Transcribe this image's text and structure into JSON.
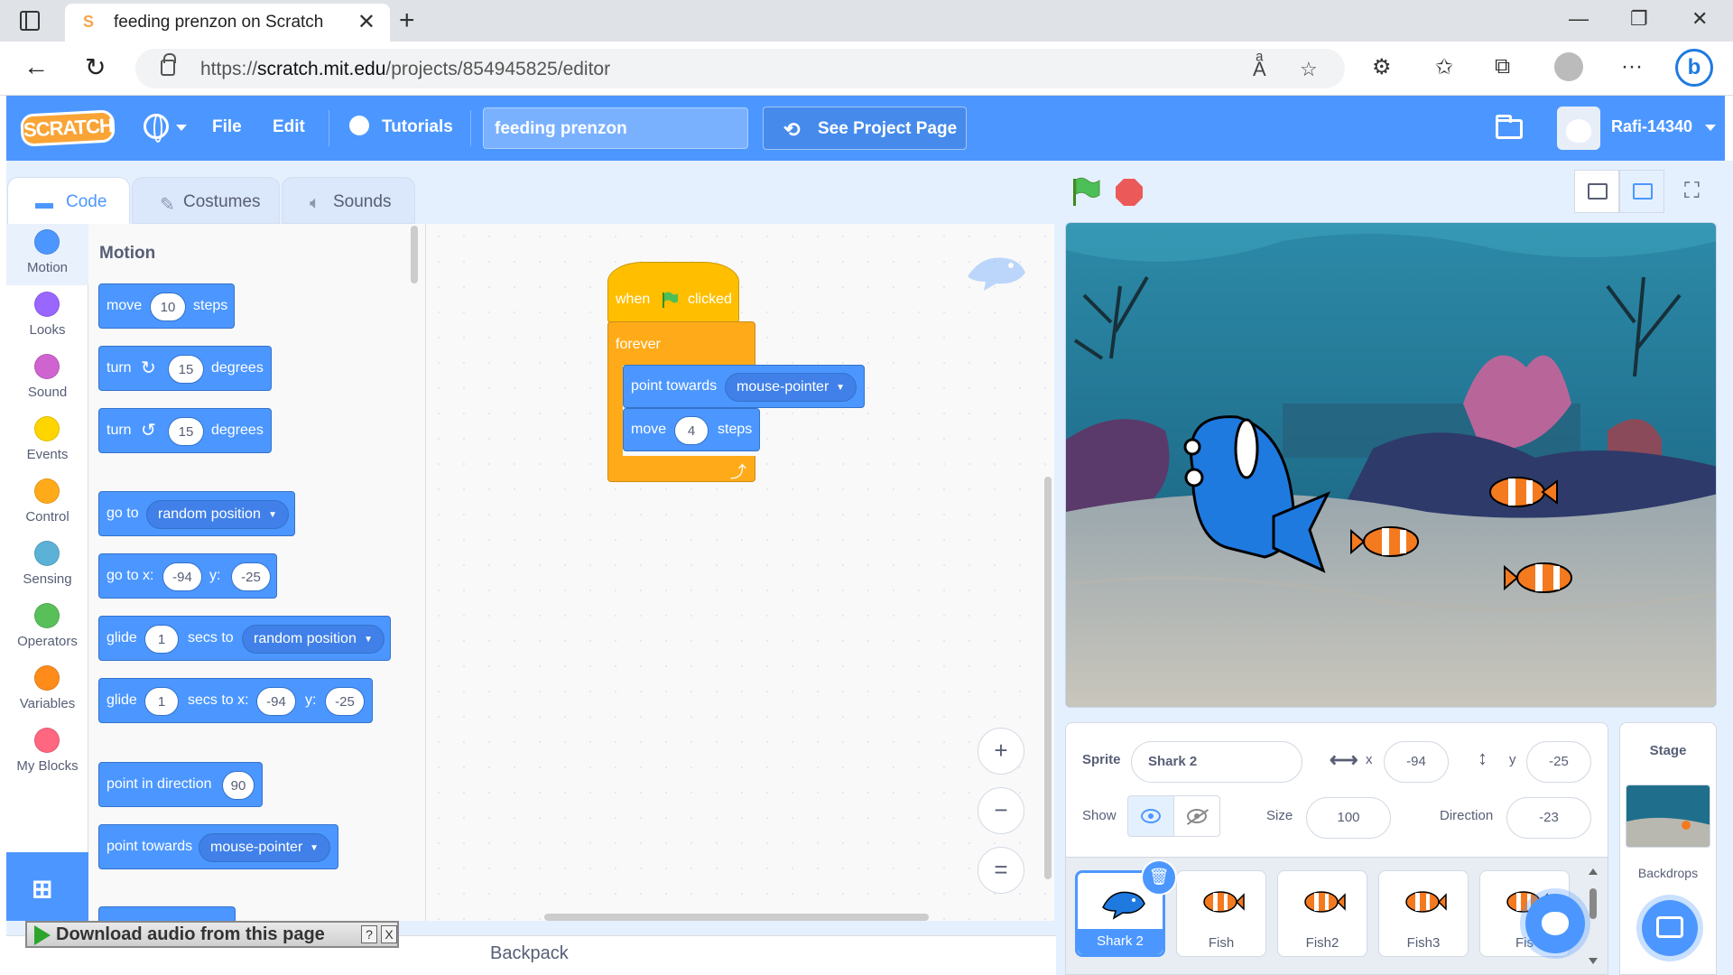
{
  "browser": {
    "tab_title": "feeding prenzon on Scratch",
    "url_prefix": "https://",
    "url_host": "scratch.mit.edu",
    "url_path": "/projects/854945825/editor"
  },
  "menubar": {
    "logo": "SCRATCH",
    "file": "File",
    "edit": "Edit",
    "tutorials": "Tutorials",
    "project_title": "feeding prenzon",
    "see_project_page": "See Project Page",
    "username": "Rafi-14340",
    "accent": "#4c97ff"
  },
  "editor_tabs": [
    {
      "label": "Code",
      "icon": "code-icon"
    },
    {
      "label": "Costumes",
      "icon": "brush-icon"
    },
    {
      "label": "Sounds",
      "icon": "speaker-icon"
    }
  ],
  "categories": [
    {
      "label": "Motion",
      "color": "#4c97ff"
    },
    {
      "label": "Looks",
      "color": "#9966ff"
    },
    {
      "label": "Sound",
      "color": "#cf63cf"
    },
    {
      "label": "Events",
      "color": "#ffd500"
    },
    {
      "label": "Control",
      "color": "#ffab19"
    },
    {
      "label": "Sensing",
      "color": "#5cb1d6"
    },
    {
      "label": "Operators",
      "color": "#59c059"
    },
    {
      "label": "Variables",
      "color": "#ff8c1a"
    },
    {
      "label": "My Blocks",
      "color": "#ff6680"
    }
  ],
  "palette": {
    "heading": "Motion",
    "move": {
      "a": "move",
      "n": "10",
      "b": "steps"
    },
    "turn_right": {
      "a": "turn",
      "n": "15",
      "b": "degrees"
    },
    "turn_left": {
      "a": "turn",
      "n": "15",
      "b": "degrees"
    },
    "goto": {
      "a": "go to",
      "d": "random position"
    },
    "goto_xy": {
      "a": "go to x:",
      "x": "-94",
      "b": "y:",
      "y": "-25"
    },
    "glide": {
      "a": "glide",
      "n": "1",
      "b": "secs to",
      "d": "random position"
    },
    "glide_xy": {
      "a": "glide",
      "n": "1",
      "b": "secs to x:",
      "x": "-94",
      "c": "y:",
      "y": "-25"
    },
    "point_dir": {
      "a": "point in direction",
      "n": "90"
    },
    "point_towards": {
      "a": "point towards",
      "d": "mouse-pointer"
    }
  },
  "script": {
    "when": "when",
    "clicked": "clicked",
    "forever": "forever",
    "point_towards": "point towards",
    "point_target": "mouse-pointer",
    "move": "move",
    "move_steps": "4",
    "steps": "steps"
  },
  "zoom": {
    "in": "+",
    "out": "−",
    "reset": "="
  },
  "backpack": "Backpack",
  "download_bar": {
    "label": "Download audio from this page",
    "help": "?",
    "close": "X"
  },
  "sprite_info": {
    "sprite_label": "Sprite",
    "sprite_name": "Shark 2",
    "x_label": "x",
    "x": "-94",
    "y_label": "y",
    "y": "-25",
    "show_label": "Show",
    "size_label": "Size",
    "size": "100",
    "direction_label": "Direction",
    "direction": "-23"
  },
  "sprites": [
    {
      "name": "Shark 2",
      "selected": true
    },
    {
      "name": "Fish",
      "selected": false
    },
    {
      "name": "Fish2",
      "selected": false
    },
    {
      "name": "Fish3",
      "selected": false
    },
    {
      "name": "Fis",
      "selected": false
    }
  ],
  "stage_panel": {
    "title": "Stage",
    "backdrops": "Backdrops"
  }
}
